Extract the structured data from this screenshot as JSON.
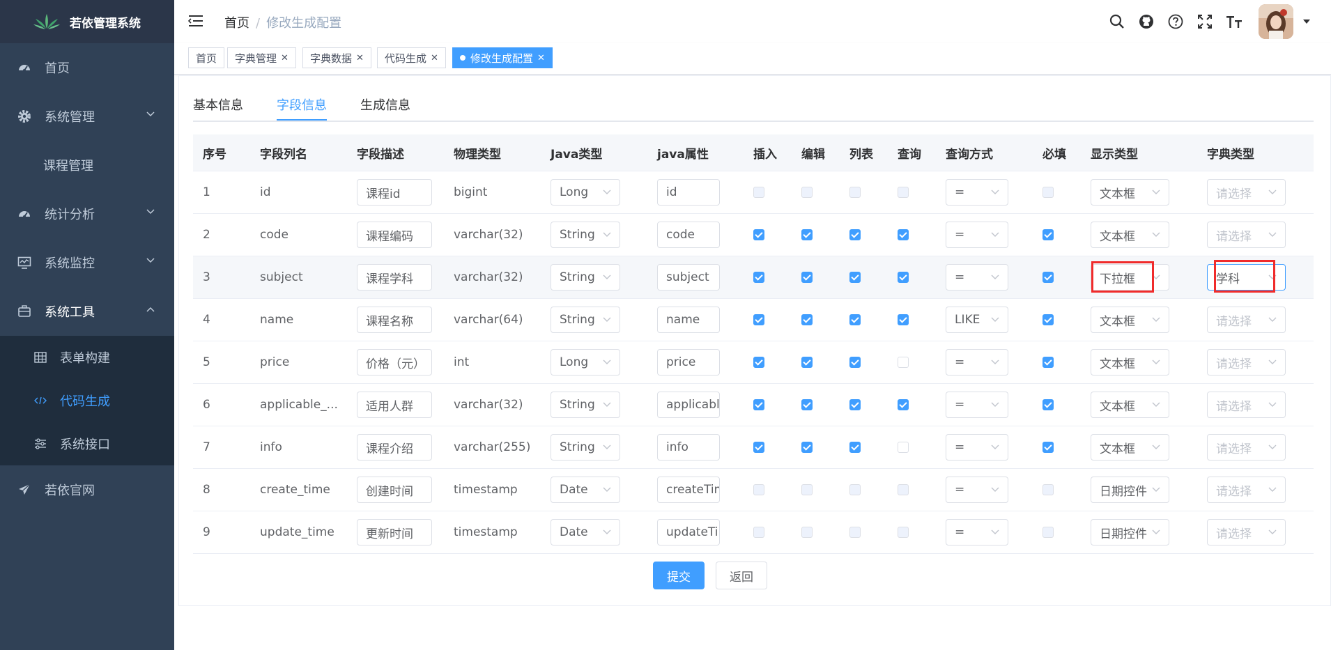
{
  "app": {
    "title": "若依管理系统"
  },
  "sidebar": {
    "items": [
      {
        "label": "首页",
        "icon": "dashboard-icon"
      },
      {
        "label": "系统管理",
        "icon": "gear-icon"
      },
      {
        "label": "课程管理"
      },
      {
        "label": "统计分析",
        "icon": "dashboard-icon"
      },
      {
        "label": "系统监控",
        "icon": "monitor-icon"
      },
      {
        "label": "系统工具",
        "icon": "toolbox-icon"
      },
      {
        "label": "若依官网",
        "icon": "send-icon"
      }
    ],
    "tool_sub": [
      {
        "label": "表单构建",
        "icon": "table-icon"
      },
      {
        "label": "代码生成",
        "icon": "code-icon"
      },
      {
        "label": "系统接口",
        "icon": "sliders-icon"
      }
    ]
  },
  "breadcrumb": {
    "home": "首页",
    "separator": "/",
    "current": "修改生成配置"
  },
  "tags": [
    {
      "label": "首页"
    },
    {
      "label": "字典管理"
    },
    {
      "label": "字典数据"
    },
    {
      "label": "代码生成"
    },
    {
      "label": "修改生成配置"
    }
  ],
  "tabs": [
    "基本信息",
    "字段信息",
    "生成信息"
  ],
  "table": {
    "headers": [
      "序号",
      "字段列名",
      "字段描述",
      "物理类型",
      "Java类型",
      "java属性",
      "插入",
      "编辑",
      "列表",
      "查询",
      "查询方式",
      "必填",
      "显示类型",
      "字典类型"
    ],
    "placeholder": "请选择",
    "rows": [
      {
        "no": "1",
        "col": "id",
        "desc": "课程id",
        "phys": "bigint",
        "jtype": "Long",
        "jprop": "id",
        "ins": false,
        "edit": false,
        "list": false,
        "query": false,
        "qmode": "=",
        "req": false,
        "disp": "文本框",
        "dict": ""
      },
      {
        "no": "2",
        "col": "code",
        "desc": "课程编码",
        "phys": "varchar(32)",
        "jtype": "String",
        "jprop": "code",
        "ins": true,
        "edit": true,
        "list": true,
        "query": true,
        "qmode": "=",
        "req": true,
        "disp": "文本框",
        "dict": ""
      },
      {
        "no": "3",
        "col": "subject",
        "desc": "课程学科",
        "phys": "varchar(32)",
        "jtype": "String",
        "jprop": "subject",
        "ins": true,
        "edit": true,
        "list": true,
        "query": true,
        "qmode": "=",
        "req": true,
        "disp": "下拉框",
        "dict": "学科"
      },
      {
        "no": "4",
        "col": "name",
        "desc": "课程名称",
        "phys": "varchar(64)",
        "jtype": "String",
        "jprop": "name",
        "ins": true,
        "edit": true,
        "list": true,
        "query": true,
        "qmode": "LIKE",
        "req": true,
        "disp": "文本框",
        "dict": ""
      },
      {
        "no": "5",
        "col": "price",
        "desc": "价格（元）",
        "phys": "int",
        "jtype": "Long",
        "jprop": "price",
        "ins": true,
        "edit": true,
        "list": true,
        "query": false,
        "qmode": "=",
        "req": true,
        "disp": "文本框",
        "dict": ""
      },
      {
        "no": "6",
        "col": "applicable_...",
        "desc": "适用人群",
        "phys": "varchar(32)",
        "jtype": "String",
        "jprop": "applicableP",
        "ins": true,
        "edit": true,
        "list": true,
        "query": true,
        "qmode": "=",
        "req": true,
        "disp": "文本框",
        "dict": ""
      },
      {
        "no": "7",
        "col": "info",
        "desc": "课程介绍",
        "phys": "varchar(255)",
        "jtype": "String",
        "jprop": "info",
        "ins": true,
        "edit": true,
        "list": true,
        "query": false,
        "qmode": "=",
        "req": true,
        "disp": "文本框",
        "dict": ""
      },
      {
        "no": "8",
        "col": "create_time",
        "desc": "创建时间",
        "phys": "timestamp",
        "jtype": "Date",
        "jprop": "createTime",
        "ins": false,
        "edit": false,
        "list": false,
        "query": false,
        "qmode": "=",
        "req": false,
        "disp": "日期控件",
        "dict": ""
      },
      {
        "no": "9",
        "col": "update_time",
        "desc": "更新时间",
        "phys": "timestamp",
        "jtype": "Date",
        "jprop": "updateTime",
        "ins": false,
        "edit": false,
        "list": false,
        "query": false,
        "qmode": "=",
        "req": false,
        "disp": "日期控件",
        "dict": ""
      }
    ]
  },
  "buttons": {
    "submit": "提交",
    "back": "返回"
  },
  "colors": {
    "sidebar_bg": "#304156",
    "accent": "#409eff",
    "highlight_box": "#f02b2b"
  }
}
